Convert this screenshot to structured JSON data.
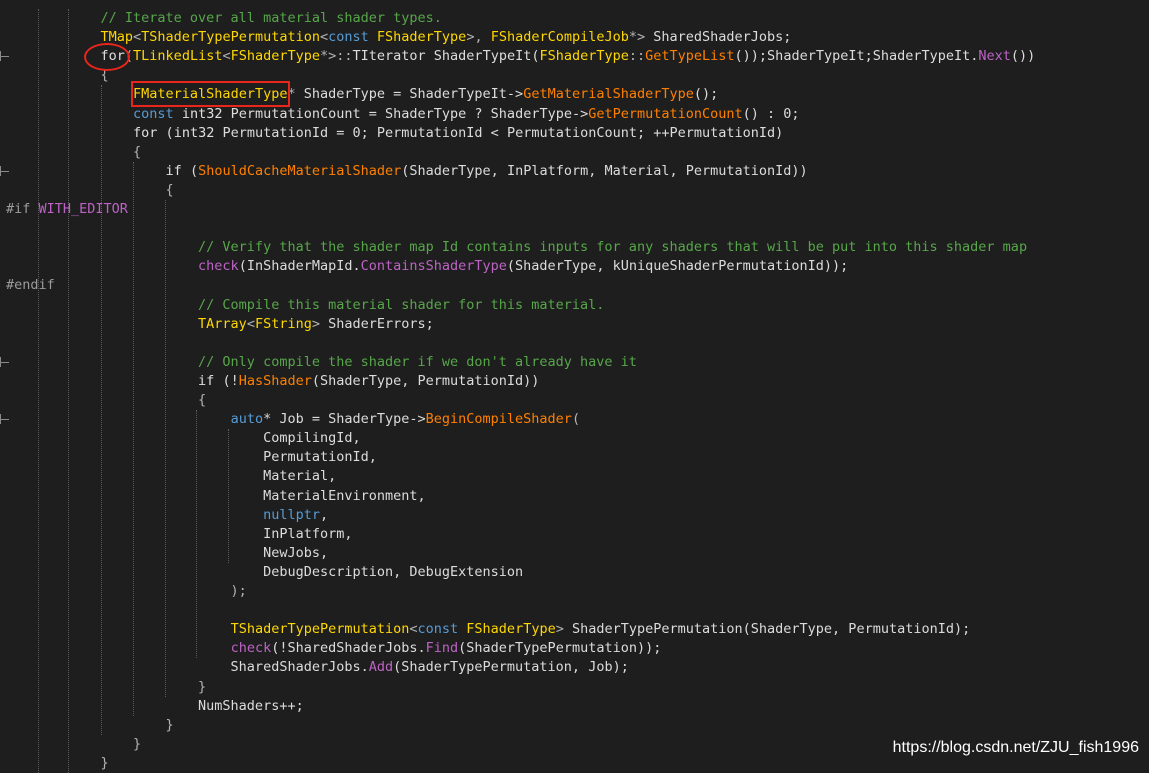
{
  "colors": {
    "background": "#1e1e1e",
    "comment": "#57a64a",
    "keyword": "#569cd6",
    "type": "#ffd700",
    "function": "#ff8000",
    "macro": "#bd63c5",
    "identifier": "#dcdcdc",
    "annotation": "#e8261c"
  },
  "code": {
    "lines": [
      {
        "indent": 0,
        "tokens": [
          {
            "t": "    // Iterate over all material shader types.",
            "k": "comment"
          }
        ]
      },
      {
        "indent": 0,
        "tokens": [
          {
            "t": "    ",
            "k": "ident"
          },
          {
            "t": "TMap",
            "k": "type"
          },
          {
            "t": "<",
            "k": "punct"
          },
          {
            "t": "TShaderTypePermutation",
            "k": "type"
          },
          {
            "t": "<",
            "k": "punct"
          },
          {
            "t": "const ",
            "k": "keyword"
          },
          {
            "t": "FShaderType",
            "k": "type"
          },
          {
            "t": ">, ",
            "k": "punct"
          },
          {
            "t": "FShaderCompileJob",
            "k": "type"
          },
          {
            "t": "*> ",
            "k": "punct"
          },
          {
            "t": "SharedShaderJobs;",
            "k": "ident"
          }
        ]
      },
      {
        "indent": 0,
        "tokens": [
          {
            "t": "    ",
            "k": "ident"
          },
          {
            "t": "for",
            "k": "white"
          },
          {
            "t": "(",
            "k": "punct"
          },
          {
            "t": "TLinkedList",
            "k": "type"
          },
          {
            "t": "<",
            "k": "punct"
          },
          {
            "t": "FShaderType",
            "k": "type"
          },
          {
            "t": "*>::",
            "k": "punct"
          },
          {
            "t": "TIterator ",
            "k": "ident"
          },
          {
            "t": "ShaderTypeIt(",
            "k": "ident"
          },
          {
            "t": "FShaderType",
            "k": "type"
          },
          {
            "t": "::",
            "k": "punct"
          },
          {
            "t": "GetTypeList",
            "k": "fn"
          },
          {
            "t": "());ShaderTypeIt;ShaderTypeIt.",
            "k": "ident"
          },
          {
            "t": "Next",
            "k": "macro"
          },
          {
            "t": "())",
            "k": "ident"
          }
        ]
      },
      {
        "indent": 0,
        "tokens": [
          {
            "t": "    {",
            "k": "punct"
          }
        ]
      },
      {
        "indent": 0,
        "tokens": [
          {
            "t": "        ",
            "k": "ident"
          },
          {
            "t": "FMaterialShaderType",
            "k": "type"
          },
          {
            "t": "* ",
            "k": "punct"
          },
          {
            "t": "ShaderType = ShaderTypeIt->",
            "k": "ident"
          },
          {
            "t": "GetMaterialShaderType",
            "k": "fn"
          },
          {
            "t": "();",
            "k": "ident"
          }
        ]
      },
      {
        "indent": 0,
        "tokens": [
          {
            "t": "        ",
            "k": "ident"
          },
          {
            "t": "const ",
            "k": "keyword"
          },
          {
            "t": "int32 ",
            "k": "white"
          },
          {
            "t": "PermutationCount = ShaderType ? ShaderType->",
            "k": "ident"
          },
          {
            "t": "GetPermutationCount",
            "k": "fn"
          },
          {
            "t": "() : 0;",
            "k": "ident"
          }
        ]
      },
      {
        "indent": 0,
        "tokens": [
          {
            "t": "        ",
            "k": "ident"
          },
          {
            "t": "for ",
            "k": "white"
          },
          {
            "t": "(",
            "k": "ident"
          },
          {
            "t": "int32 ",
            "k": "white"
          },
          {
            "t": "PermutationId = 0; PermutationId < PermutationCount; ++PermutationId)",
            "k": "ident"
          }
        ]
      },
      {
        "indent": 0,
        "tokens": [
          {
            "t": "        {",
            "k": "punct"
          }
        ]
      },
      {
        "indent": 0,
        "tokens": [
          {
            "t": "            ",
            "k": "ident"
          },
          {
            "t": "if ",
            "k": "white"
          },
          {
            "t": "(",
            "k": "ident"
          },
          {
            "t": "ShouldCacheMaterialShader",
            "k": "fn"
          },
          {
            "t": "(ShaderType, InPlatform, Material, PermutationId))",
            "k": "ident"
          }
        ]
      },
      {
        "indent": 0,
        "tokens": [
          {
            "t": "            {",
            "k": "punct"
          }
        ]
      },
      {
        "indent": 0,
        "tokens": [
          {
            "t": "#if ",
            "k": "pp"
          },
          {
            "t": "WITH_EDITOR",
            "k": "macro"
          }
        ]
      },
      {
        "indent": 0,
        "tokens": [
          {
            "t": "",
            "k": "ident"
          }
        ]
      },
      {
        "indent": 0,
        "tokens": [
          {
            "t": "                // Verify that the shader map Id contains inputs for any shaders that will be put into this shader map",
            "k": "comment"
          }
        ]
      },
      {
        "indent": 0,
        "tokens": [
          {
            "t": "                ",
            "k": "ident"
          },
          {
            "t": "check",
            "k": "macro"
          },
          {
            "t": "(InShaderMapId.",
            "k": "ident"
          },
          {
            "t": "ContainsShaderType",
            "k": "macro"
          },
          {
            "t": "(ShaderType, kUniqueShaderPermutationId));",
            "k": "ident"
          }
        ]
      },
      {
        "indent": 0,
        "tokens": [
          {
            "t": "#endif",
            "k": "pp"
          }
        ]
      },
      {
        "indent": 0,
        "tokens": [
          {
            "t": "                // Compile this material shader for this material.",
            "k": "comment"
          }
        ]
      },
      {
        "indent": 0,
        "tokens": [
          {
            "t": "                ",
            "k": "ident"
          },
          {
            "t": "TArray",
            "k": "type"
          },
          {
            "t": "<",
            "k": "punct"
          },
          {
            "t": "FString",
            "k": "type"
          },
          {
            "t": "> ",
            "k": "punct"
          },
          {
            "t": "ShaderErrors;",
            "k": "ident"
          }
        ]
      },
      {
        "indent": 0,
        "tokens": [
          {
            "t": "",
            "k": "ident"
          }
        ]
      },
      {
        "indent": 0,
        "tokens": [
          {
            "t": "                // Only compile the shader if we don't already have it",
            "k": "comment"
          }
        ]
      },
      {
        "indent": 0,
        "tokens": [
          {
            "t": "                ",
            "k": "ident"
          },
          {
            "t": "if ",
            "k": "white"
          },
          {
            "t": "(!",
            "k": "ident"
          },
          {
            "t": "HasShader",
            "k": "fn"
          },
          {
            "t": "(ShaderType, PermutationId))",
            "k": "ident"
          }
        ]
      },
      {
        "indent": 0,
        "tokens": [
          {
            "t": "                {",
            "k": "punct"
          }
        ]
      },
      {
        "indent": 0,
        "tokens": [
          {
            "t": "                    ",
            "k": "ident"
          },
          {
            "t": "auto",
            "k": "keyword"
          },
          {
            "t": "* Job = ShaderType->",
            "k": "ident"
          },
          {
            "t": "BeginCompileShader",
            "k": "fn"
          },
          {
            "t": "(",
            "k": "punct"
          }
        ]
      },
      {
        "indent": 0,
        "tokens": [
          {
            "t": "                        CompilingId,",
            "k": "ident"
          }
        ]
      },
      {
        "indent": 0,
        "tokens": [
          {
            "t": "                        PermutationId,",
            "k": "ident"
          }
        ]
      },
      {
        "indent": 0,
        "tokens": [
          {
            "t": "                        Material,",
            "k": "ident"
          }
        ]
      },
      {
        "indent": 0,
        "tokens": [
          {
            "t": "                        MaterialEnvironment,",
            "k": "ident"
          }
        ]
      },
      {
        "indent": 0,
        "tokens": [
          {
            "t": "                        ",
            "k": "ident"
          },
          {
            "t": "nullptr",
            "k": "keyword"
          },
          {
            "t": ",",
            "k": "ident"
          }
        ]
      },
      {
        "indent": 0,
        "tokens": [
          {
            "t": "                        InPlatform,",
            "k": "ident"
          }
        ]
      },
      {
        "indent": 0,
        "tokens": [
          {
            "t": "                        NewJobs,",
            "k": "ident"
          }
        ]
      },
      {
        "indent": 0,
        "tokens": [
          {
            "t": "                        DebugDescription, DebugExtension",
            "k": "ident"
          }
        ]
      },
      {
        "indent": 0,
        "tokens": [
          {
            "t": "                    );",
            "k": "punct"
          }
        ]
      },
      {
        "indent": 0,
        "tokens": [
          {
            "t": "",
            "k": "ident"
          }
        ]
      },
      {
        "indent": 0,
        "tokens": [
          {
            "t": "                    ",
            "k": "ident"
          },
          {
            "t": "TShaderTypePermutation",
            "k": "type"
          },
          {
            "t": "<",
            "k": "punct"
          },
          {
            "t": "const ",
            "k": "keyword"
          },
          {
            "t": "FShaderType",
            "k": "type"
          },
          {
            "t": "> ",
            "k": "punct"
          },
          {
            "t": "ShaderTypePermutation(ShaderType, PermutationId);",
            "k": "ident"
          }
        ]
      },
      {
        "indent": 0,
        "tokens": [
          {
            "t": "                    ",
            "k": "ident"
          },
          {
            "t": "check",
            "k": "macro"
          },
          {
            "t": "(!SharedShaderJobs.",
            "k": "ident"
          },
          {
            "t": "Find",
            "k": "macro"
          },
          {
            "t": "(ShaderTypePermutation));",
            "k": "ident"
          }
        ]
      },
      {
        "indent": 0,
        "tokens": [
          {
            "t": "                    SharedShaderJobs.",
            "k": "ident"
          },
          {
            "t": "Add",
            "k": "macro"
          },
          {
            "t": "(ShaderTypePermutation, Job);",
            "k": "ident"
          }
        ]
      },
      {
        "indent": 0,
        "tokens": [
          {
            "t": "                }",
            "k": "punct"
          }
        ]
      },
      {
        "indent": 0,
        "tokens": [
          {
            "t": "                NumShaders++;",
            "k": "ident"
          }
        ]
      },
      {
        "indent": 0,
        "tokens": [
          {
            "t": "            }",
            "k": "punct"
          }
        ]
      },
      {
        "indent": 0,
        "tokens": [
          {
            "t": "        }",
            "k": "punct"
          }
        ]
      },
      {
        "indent": 0,
        "tokens": [
          {
            "t": "    }",
            "k": "punct"
          }
        ]
      }
    ]
  },
  "watermark": "https://blog.csdn.net/ZJU_fish1996"
}
